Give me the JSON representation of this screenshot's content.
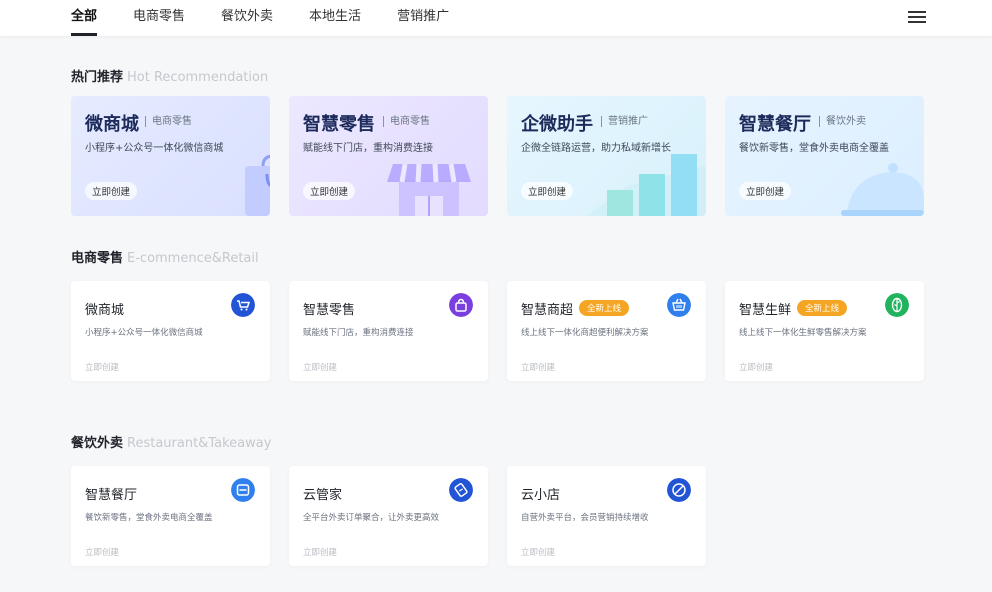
{
  "nav": {
    "tabs": [
      "全部",
      "电商零售",
      "餐饮外卖",
      "本地生活",
      "营销推广"
    ],
    "active": 0
  },
  "sections": {
    "hot": {
      "title": "热门推荐",
      "en": "Hot Recommendation"
    },
    "ecommerce": {
      "title": "电商零售",
      "en": "E-commence&Retail"
    },
    "restaurant": {
      "title": "餐饮外卖",
      "en": "Restaurant&Takeaway"
    }
  },
  "hero": [
    {
      "title": "微商城",
      "tag": "电商零售",
      "desc": "小程序+公众号一体化微信商城",
      "btn": "立即创建",
      "art": "shopping-bag-icon"
    },
    {
      "title": "智慧零售",
      "tag": "电商零售",
      "desc": "赋能线下门店，重构消费连接",
      "btn": "立即创建",
      "art": "storefront-icon"
    },
    {
      "title": "企微助手",
      "tag": "营销推广",
      "desc": "企微全链路运营，助力私域新增长",
      "btn": "立即创建",
      "art": "bar-growth-icon"
    },
    {
      "title": "智慧餐厅",
      "tag": "餐饮外卖",
      "desc": "餐饮新零售，堂食外卖电商全覆盖",
      "btn": "立即创建",
      "art": "food-cloche-icon"
    }
  ],
  "ecommerce_cards": [
    {
      "title": "微商城",
      "desc": "小程序+公众号一体化微信商城",
      "link": "立即创建",
      "badge": "",
      "icon": "cart-icon",
      "color": "#2255d6"
    },
    {
      "title": "智慧零售",
      "desc": "赋能线下门店，重构消费连接",
      "link": "立即创建",
      "badge": "",
      "icon": "shopping-bag-icon",
      "color": "#7b3fe0"
    },
    {
      "title": "智慧商超",
      "desc": "线上线下一体化商超便利解决方案",
      "link": "立即创建",
      "badge": "全新上线",
      "icon": "basket-icon",
      "color": "#2f80ed"
    },
    {
      "title": "智慧生鲜",
      "desc": "线上线下一体化生鲜零售解决方案",
      "link": "立即创建",
      "badge": "全新上线",
      "icon": "leaf-icon",
      "color": "#21b45f"
    }
  ],
  "restaurant_cards": [
    {
      "title": "智慧餐厅",
      "desc": "餐饮新零售，堂食外卖电商全覆盖",
      "link": "立即创建",
      "badge": "",
      "icon": "scan-icon",
      "color": "#2f80ed"
    },
    {
      "title": "云管家",
      "desc": "全平台外卖订单聚合，让外卖更高效",
      "link": "立即创建",
      "badge": "",
      "icon": "ticket-icon",
      "color": "#2255d6"
    },
    {
      "title": "云小店",
      "desc": "自营外卖平台，会员营销持续增收",
      "link": "立即创建",
      "badge": "",
      "icon": "store-slash-icon",
      "color": "#2255d6"
    }
  ]
}
